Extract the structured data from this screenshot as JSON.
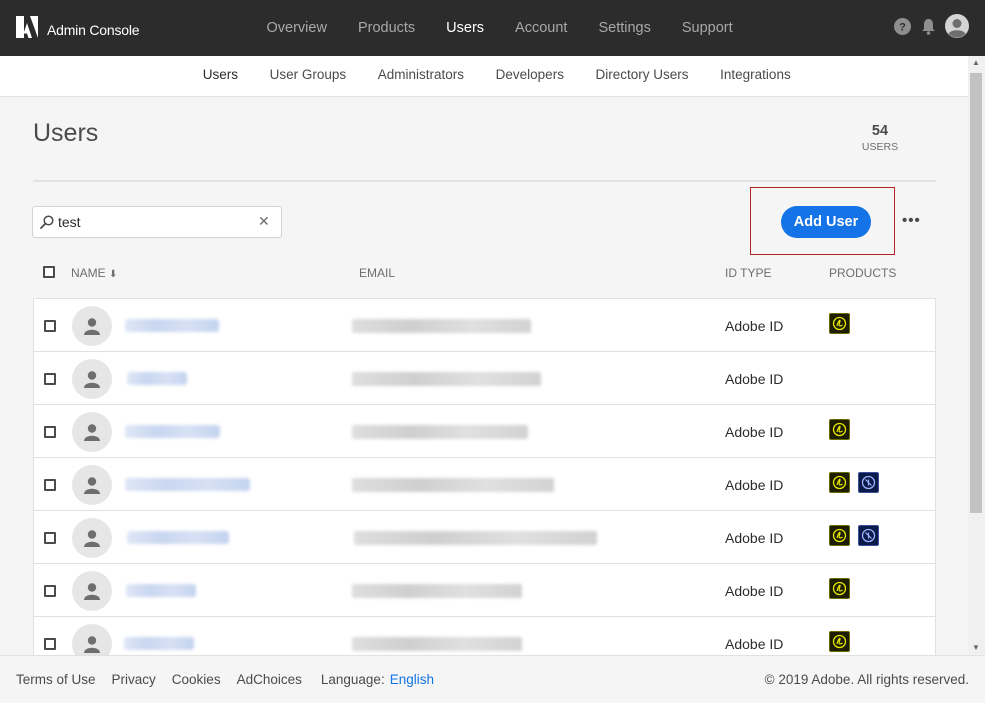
{
  "app": {
    "name": "Admin Console"
  },
  "nav": {
    "items": [
      "Overview",
      "Products",
      "Users",
      "Account",
      "Settings",
      "Support"
    ],
    "active": "Users"
  },
  "subnav": {
    "items": [
      "Users",
      "User Groups",
      "Administrators",
      "Developers",
      "Directory Users",
      "Integrations"
    ],
    "active": "Users"
  },
  "page": {
    "title": "Users",
    "count": "54",
    "count_label": "USERS"
  },
  "search": {
    "value": "test",
    "placeholder": ""
  },
  "toolbar": {
    "add_user_label": "Add User",
    "more_label": "•••"
  },
  "table": {
    "columns": {
      "name": "NAME",
      "sort_indicator": "⬇",
      "email": "EMAIL",
      "id_type": "ID TYPE",
      "products": "PRODUCTS"
    },
    "rows": [
      {
        "id_type": "Adobe ID",
        "products": [
          "acrobat"
        ]
      },
      {
        "id_type": "Adobe ID",
        "products": []
      },
      {
        "id_type": "Adobe ID",
        "products": [
          "acrobat"
        ]
      },
      {
        "id_type": "Adobe ID",
        "products": [
          "acrobat",
          "xd"
        ]
      },
      {
        "id_type": "Adobe ID",
        "products": [
          "acrobat",
          "xd"
        ]
      },
      {
        "id_type": "Adobe ID",
        "products": [
          "acrobat"
        ]
      },
      {
        "id_type": "Adobe ID",
        "products": [
          "acrobat"
        ]
      }
    ]
  },
  "footer": {
    "links": [
      "Terms of Use",
      "Privacy",
      "Cookies",
      "AdChoices"
    ],
    "language_label": "Language:",
    "language_value": "English",
    "copyright": "© 2019 Adobe. All rights reserved."
  },
  "colors": {
    "accent": "#1473e6",
    "topbar": "#2c2c2c",
    "highlight": "#b32424"
  },
  "icons": [
    "adobe-logo-icon",
    "help-icon",
    "bell-icon",
    "profile-icon",
    "search-icon",
    "clear-icon",
    "user-avatar-icon",
    "acrobat-product-icon",
    "xd-product-icon"
  ]
}
